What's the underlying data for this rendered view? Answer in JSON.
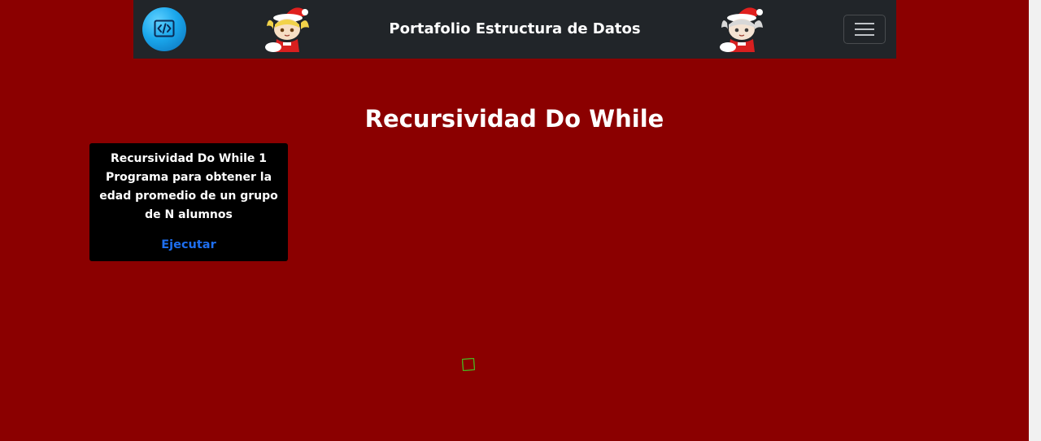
{
  "navbar": {
    "title": "Portafolio Estructura de Datos",
    "logo_icon": "code-icon",
    "toggler_icon": "hamburger-menu-icon",
    "bg_color": "#212529"
  },
  "main": {
    "heading": "Recursividad Do While",
    "bg_color": "#8b0000"
  },
  "cards": [
    {
      "title": "Recursividad Do While 1 Programa para obtener la edad promedio de un grupo de N alumnos",
      "link_label": "Ejecutar",
      "link_color": "#1e6ff0"
    }
  ]
}
